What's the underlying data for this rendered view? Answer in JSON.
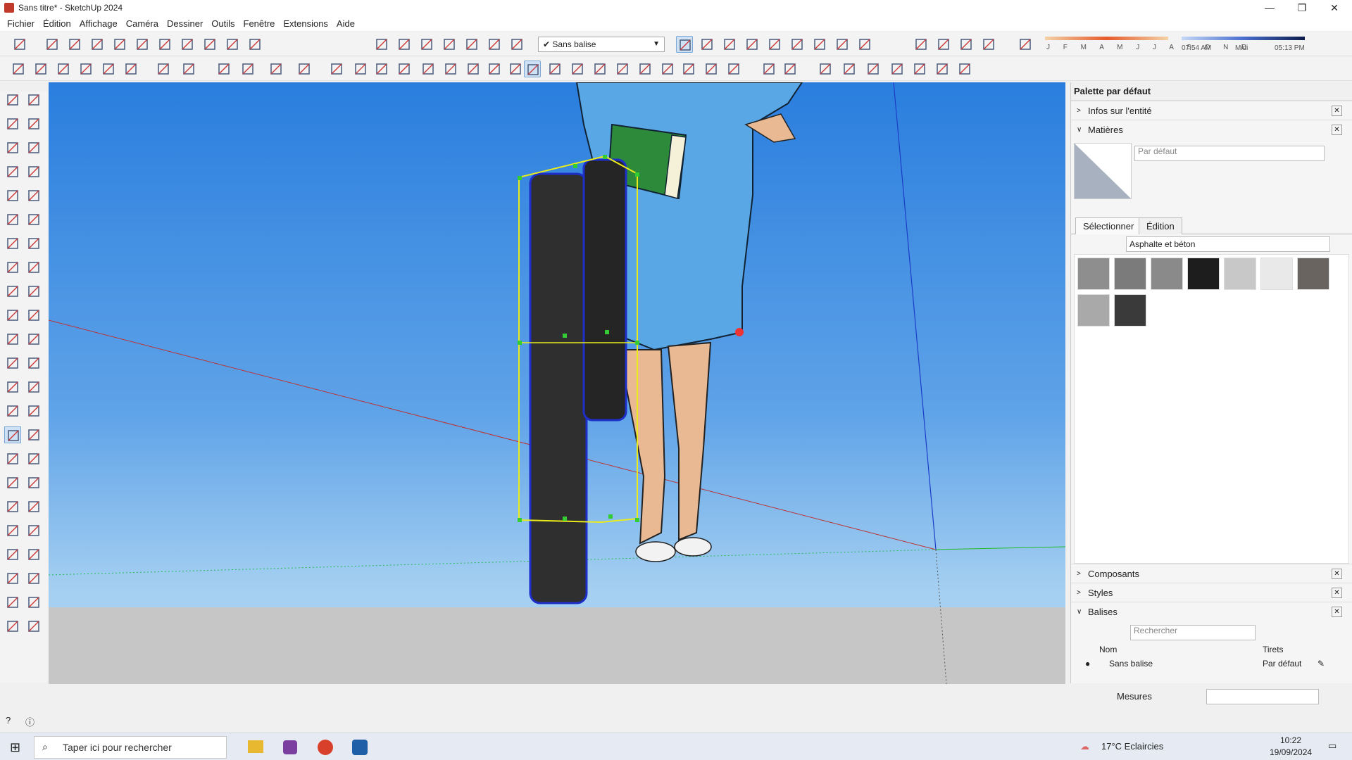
{
  "window": {
    "title": "Sans titre* - SketchUp 2024",
    "minimize": "—",
    "maximize": "❐",
    "close": "✕"
  },
  "menu": [
    "Fichier",
    "Édition",
    "Affichage",
    "Caméra",
    "Dessiner",
    "Outils",
    "Fenêtre",
    "Extensions",
    "Aide"
  ],
  "toolbar": {
    "tag_selected": "Sans balise",
    "tag_check": "✔"
  },
  "shadow": {
    "months": "J F M A M J J A S O N D",
    "time_start": "07:54 AM",
    "time_mid": "Midi",
    "time_end": "05:13 PM"
  },
  "panel": {
    "title": "Palette par défaut",
    "entity_info": "Infos sur l'entité",
    "materials": "Matières",
    "material_name": "Par défaut",
    "tab_select": "Sélectionner",
    "tab_edit": "Édition",
    "library": "Asphalte et béton",
    "swatch_colors": [
      "#8e8e8e",
      "#7b7b7b",
      "#8a8a8a",
      "#1d1d1d",
      "#c8c8c8",
      "#e9e9e9",
      "#6a6460",
      "#a9a9a9",
      "#3a3a3a"
    ],
    "components": "Composants",
    "styles": "Styles",
    "tags": "Balises",
    "tags_search_placeholder": "Rechercher",
    "col_name": "Nom",
    "col_dashes": "Tirets",
    "tag_row_name": "Sans balise",
    "tag_row_dash": "Par défaut"
  },
  "measures_label": "Mesures",
  "taskbar": {
    "search_placeholder": "Taper ici pour rechercher",
    "weather": "17°C  Eclaircies",
    "time": "10:22",
    "date": "19/09/2024"
  }
}
